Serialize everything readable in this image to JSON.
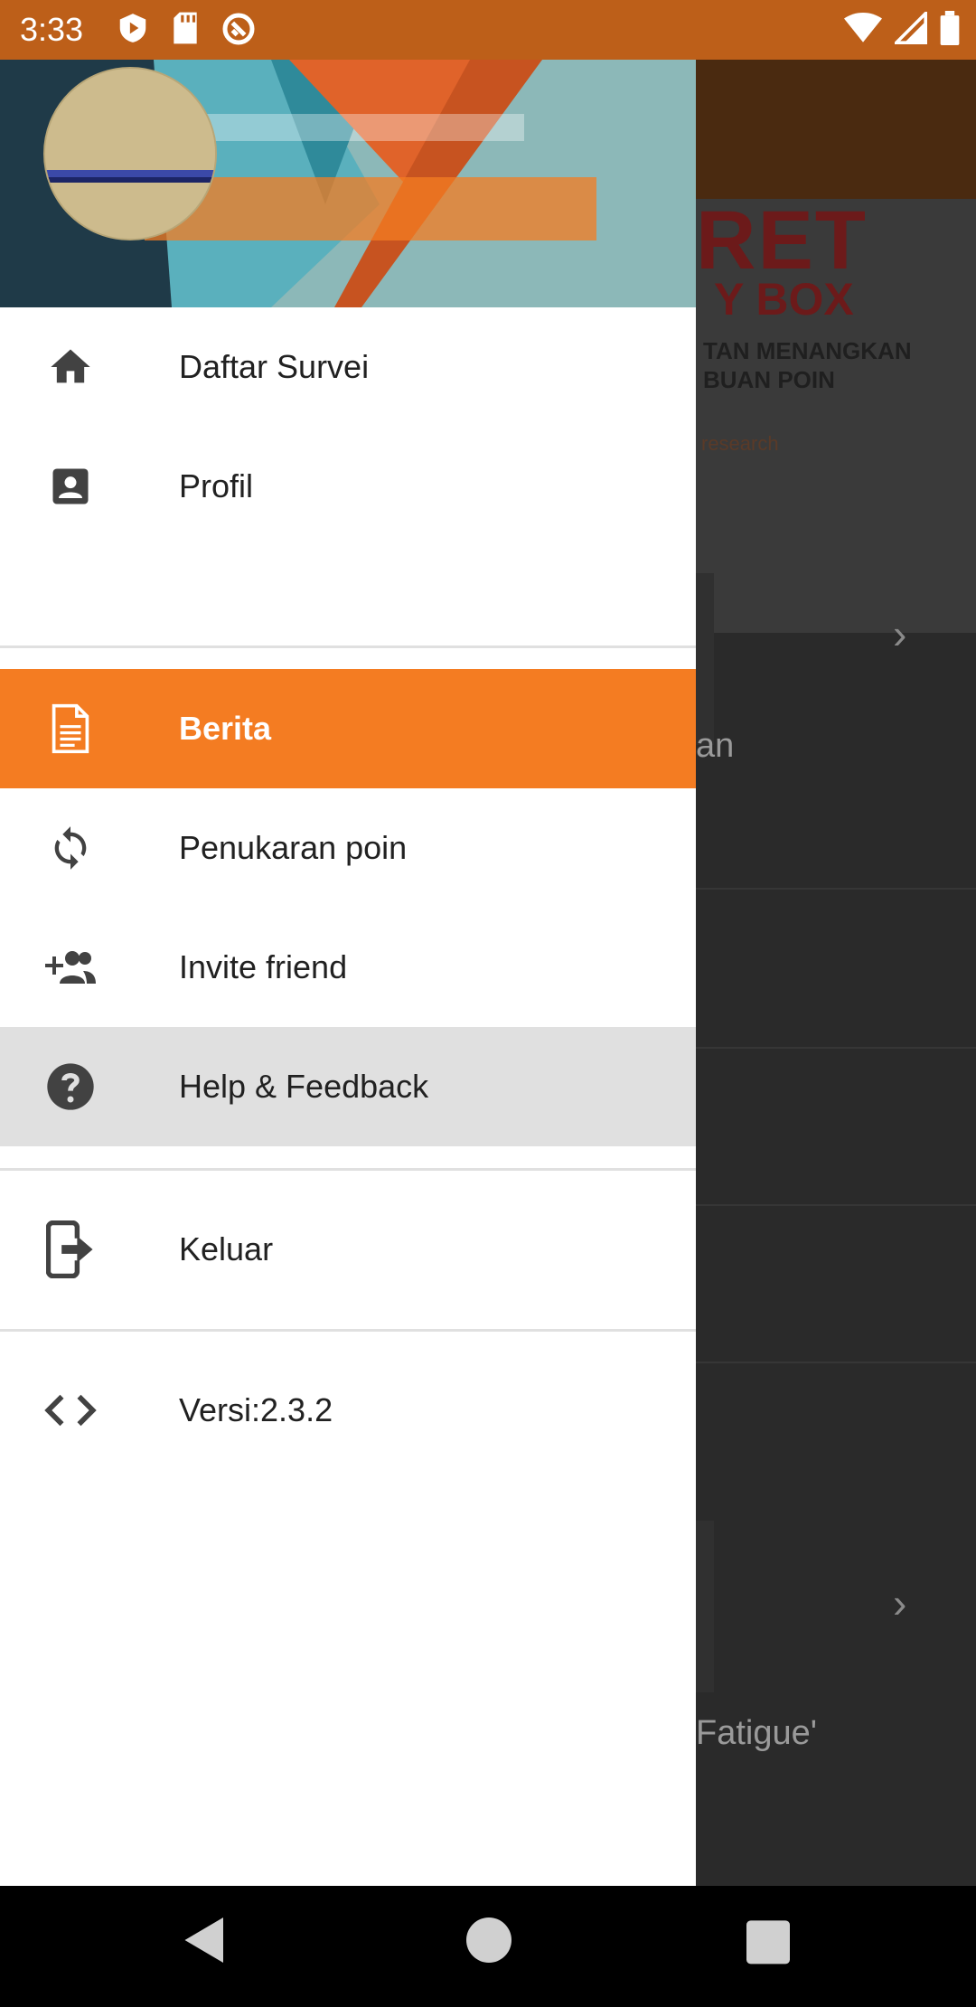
{
  "status": {
    "time": "3:33"
  },
  "colors": {
    "accent": "#f47c22",
    "status_bar": "#bd5f19",
    "hover": "#e0e0e0"
  },
  "background": {
    "banner_line1": "RET",
    "banner_line2": "Y BOX",
    "banner_line3": "TAN MENANGKAN",
    "banner_line4": "BUAN POIN",
    "banner_line5": "research",
    "item1_text": "an",
    "item2_text": "Fatigue'"
  },
  "drawer": {
    "items": [
      {
        "label": "Daftar Survei",
        "icon": "home-icon"
      },
      {
        "label": "Profil",
        "icon": "account-box-icon"
      },
      {
        "label": "Berita",
        "icon": "document-icon",
        "active": true
      },
      {
        "label": "Penukaran poin",
        "icon": "refresh-icon"
      },
      {
        "label": "Invite friend",
        "icon": "person-add-icon"
      },
      {
        "label": "Help & Feedback",
        "icon": "help-icon"
      },
      {
        "label": "Keluar",
        "icon": "logout-icon"
      },
      {
        "label": "Versi:2.3.2",
        "icon": "code-icon"
      }
    ]
  }
}
